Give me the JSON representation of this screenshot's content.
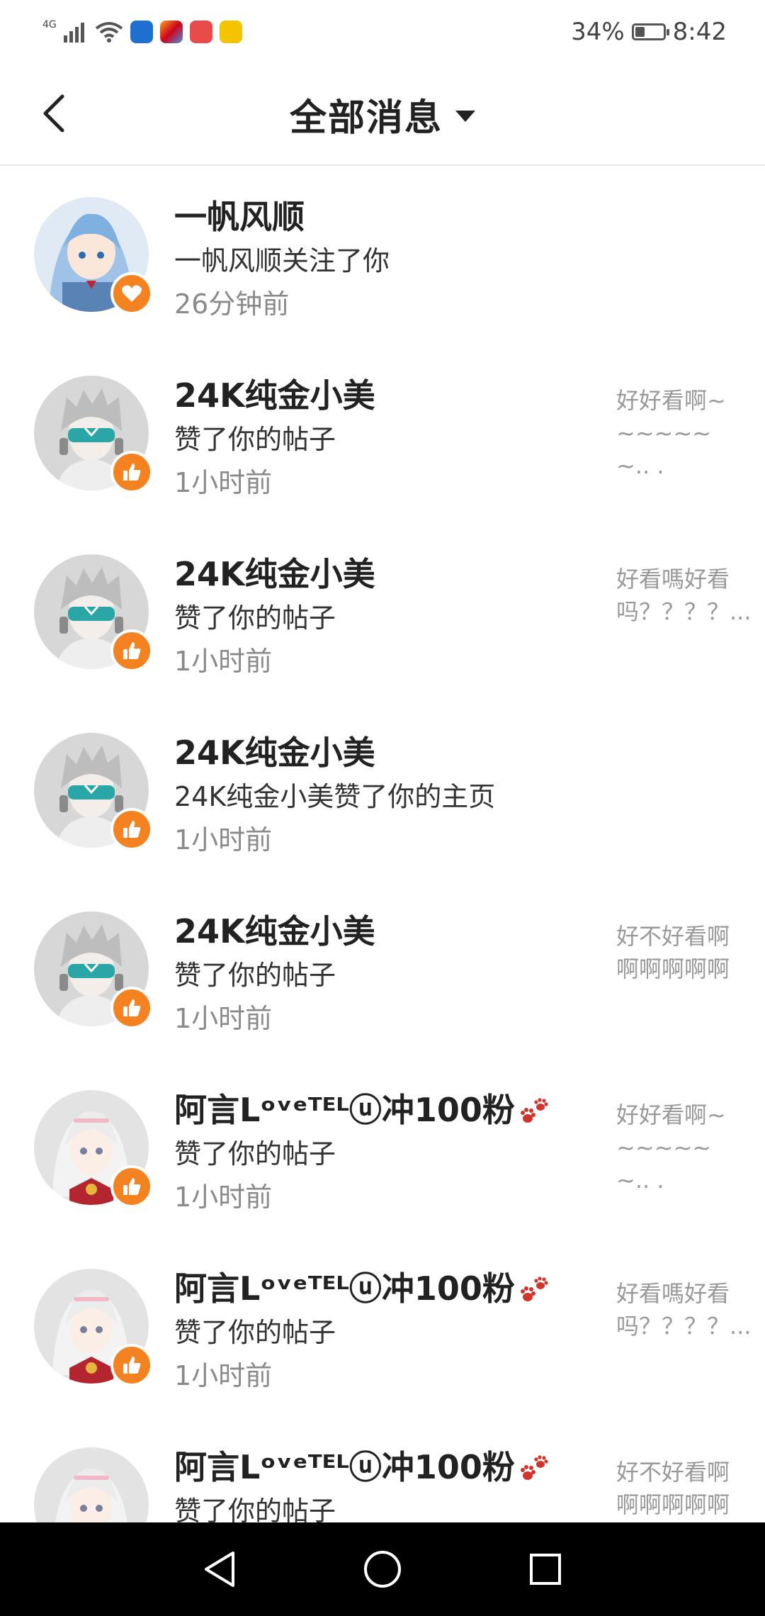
{
  "status_bar": {
    "network": "4G",
    "battery_text": "34%",
    "battery_level": 0.34,
    "time": "8:42",
    "app_icons": [
      "shield-app-icon",
      "t-app-icon",
      "book-app-icon",
      "folder-app-icon"
    ]
  },
  "header": {
    "title": "全部消息",
    "back_icon": "chevron-left-icon",
    "dropdown_icon": "caret-down-icon"
  },
  "colors": {
    "badge_orange": "#f58220",
    "heart_yellow": "#f7b500",
    "text_primary": "#222222",
    "text_secondary": "#8a8a8a",
    "preview_text": "#999999",
    "divider": "#e6e6e6"
  },
  "messages": [
    {
      "name": "一帆风顺",
      "action": "一帆风顺关注了你",
      "time": "26分钟前",
      "preview": "",
      "badge": "heart-icon",
      "avatar": "avatar-blue-hair"
    },
    {
      "name": "24K纯金小美",
      "action": "赞了你的帖子",
      "time": "1小时前",
      "preview": "好好看啊~~~~~~~..  .",
      "badge": "thumbs-up-icon",
      "avatar": "avatar-gray-hair"
    },
    {
      "name": "24K纯金小美",
      "action": "赞了你的帖子",
      "time": "1小时前",
      "preview": "好看嗎好看吗？？？？...",
      "badge": "thumbs-up-icon",
      "avatar": "avatar-gray-hair"
    },
    {
      "name": "24K纯金小美",
      "action": "24K纯金小美赞了你的主页",
      "time": "1小时前",
      "preview": "",
      "badge": "thumbs-up-icon",
      "avatar": "avatar-gray-hair"
    },
    {
      "name": "24K纯金小美",
      "action": "赞了你的帖子",
      "time": "1小时前",
      "preview": "好不好看啊啊啊啊啊啊",
      "badge": "thumbs-up-icon",
      "avatar": "avatar-gray-hair"
    },
    {
      "name": "阿言Lᵒᵛᵉᵀᴱᴸⓤ冲100粉",
      "action": "赞了你的帖子",
      "time": "1小时前",
      "preview": "好好看啊~~~~~~~..  .",
      "badge": "thumbs-up-icon",
      "avatar": "avatar-white-hair"
    },
    {
      "name": "阿言Lᵒᵛᵉᵀᴱᴸⓤ冲100粉",
      "action": "赞了你的帖子",
      "time": "1小时前",
      "preview": "好看嗎好看吗？？？？...",
      "badge": "thumbs-up-icon",
      "avatar": "avatar-white-hair"
    },
    {
      "name": "阿言Lᵒᵛᵉᵀᴱᴸⓤ冲100粉",
      "action": "赞了你的帖子",
      "time": "",
      "preview": "好不好看啊啊啊啊啊啊",
      "badge": "thumbs-up-icon",
      "avatar": "avatar-white-hair"
    }
  ],
  "nav_bar": {
    "back_icon": "triangle-back-icon",
    "home_icon": "circle-home-icon",
    "recents_icon": "square-recents-icon"
  }
}
